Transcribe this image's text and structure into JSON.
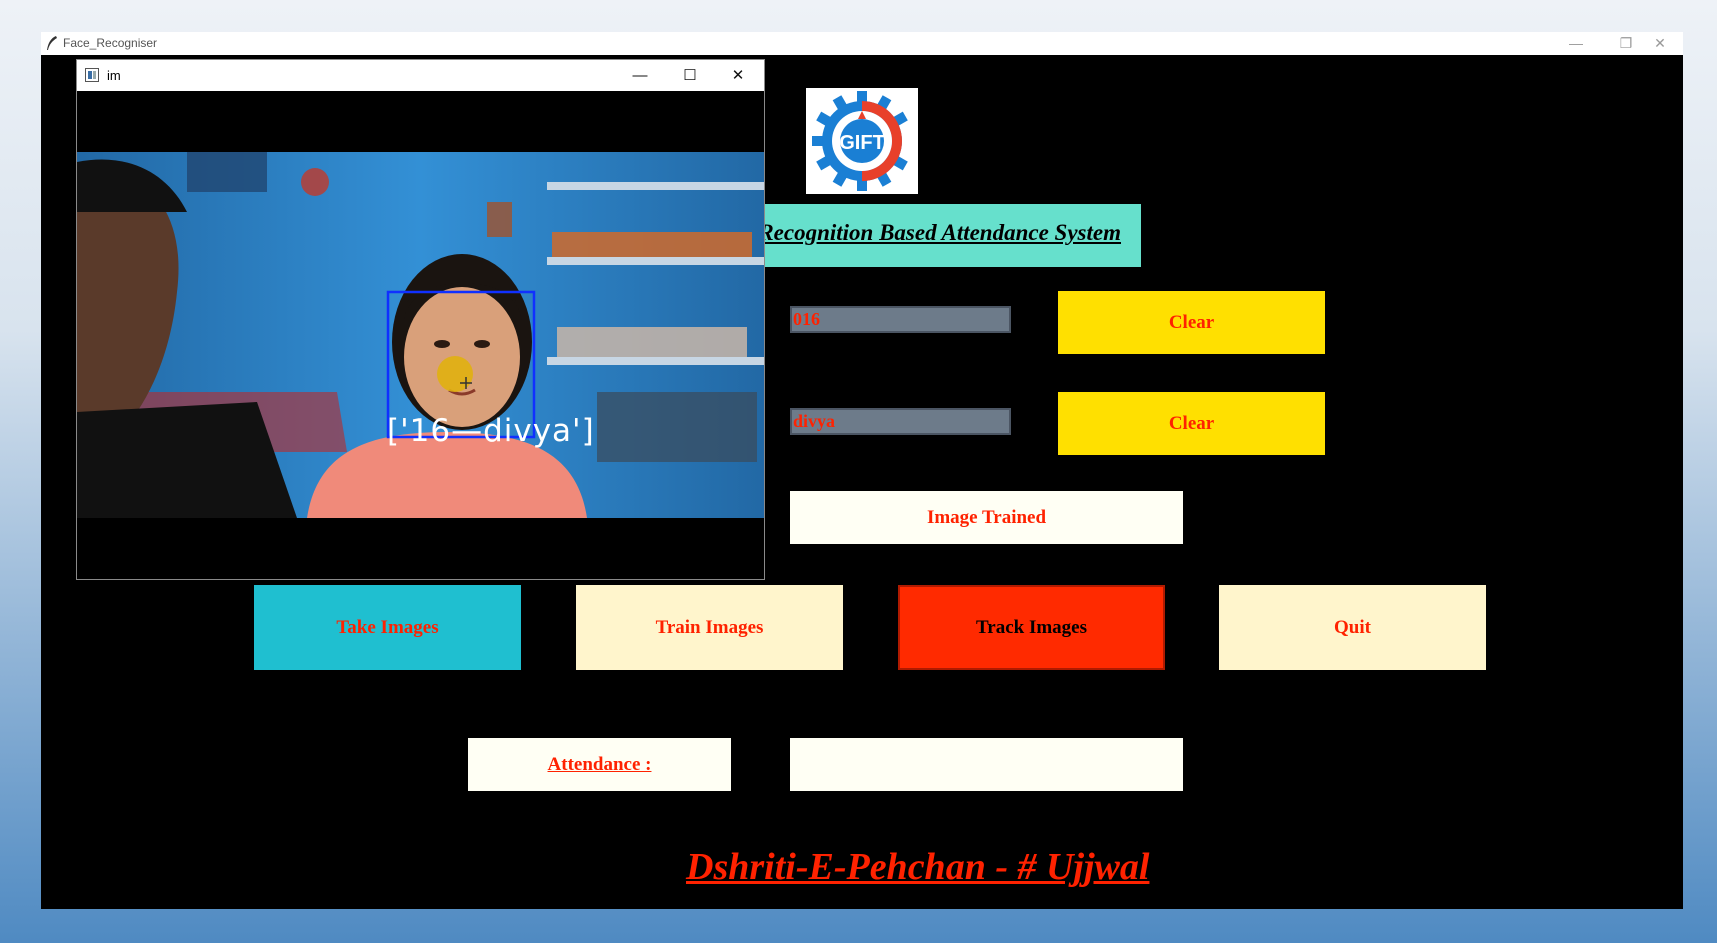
{
  "main_window": {
    "title": "Face_Recogniser",
    "controls": {
      "minimize": "—",
      "restore": "❐",
      "close": "✕"
    }
  },
  "logo": {
    "text": "GIFT"
  },
  "title_banner": "Face Recognition Based Attendance System",
  "form": {
    "id_value": "016",
    "name_value": "divya",
    "clear_label_1": "Clear",
    "clear_label_2": "Clear"
  },
  "message": "Image Trained",
  "buttons": {
    "take_images": "Take Images",
    "train_images": "Train Images",
    "track_images": "Track Images",
    "quit": "Quit"
  },
  "attendance": {
    "label": "Attendance :",
    "value": ""
  },
  "footer": "Dshriti-E-Pehchan - # Ujjwal",
  "camera_window": {
    "title": "im",
    "controls": {
      "minimize": "—",
      "maximize": "☐",
      "close": "✕"
    },
    "detected_label": "['16—divya']"
  },
  "colors": {
    "accent_red": "#ff2200",
    "clear_yellow": "#ffe000",
    "banner_teal": "#66e0cc",
    "take_cyan": "#1fbfd0",
    "cream": "#fff5cc",
    "track_red": "#ff2a00"
  }
}
